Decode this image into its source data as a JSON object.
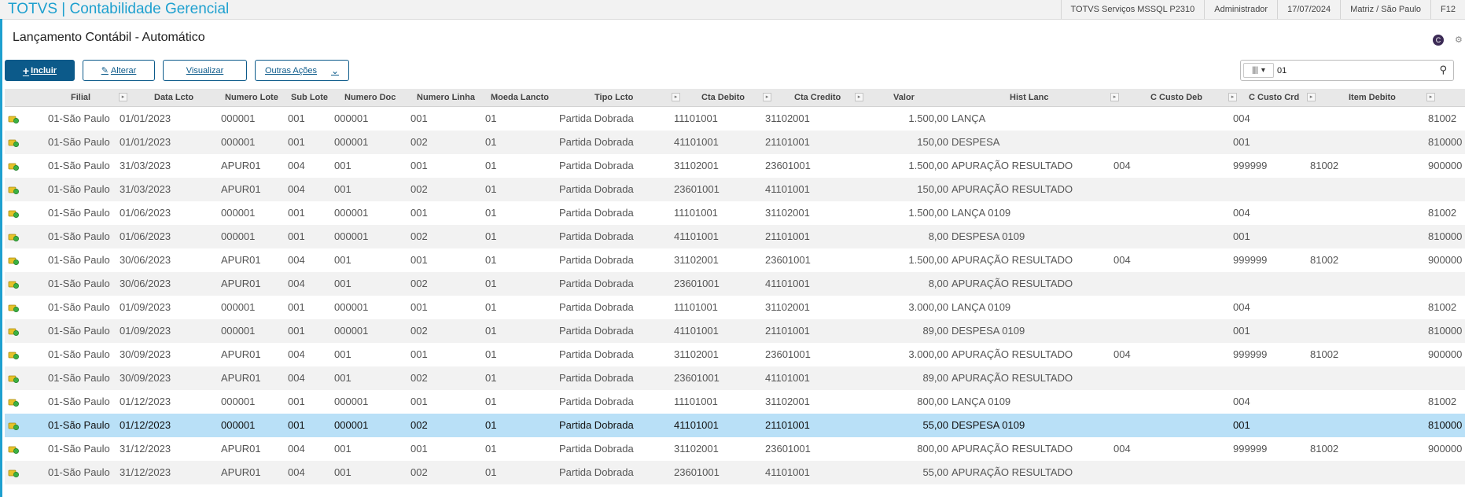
{
  "app": {
    "brand": "TOTVS | Contabilidade Gerencial"
  },
  "topbar": {
    "items": [
      "TOTVS Serviços MSSQL P2310",
      "Administrador",
      "17/07/2024",
      "Matriz / São Paulo",
      "F12"
    ]
  },
  "page": {
    "title": "Lançamento Contábil - Automático",
    "icon_letter": "C"
  },
  "toolbar": {
    "incluir_label": "Incluir",
    "alterar_label": "Alterar",
    "visualizar_label": "Visualizar",
    "outras_label": "Outras Ações"
  },
  "search": {
    "value": "01"
  },
  "colors": {
    "brand": "#1ea0cf",
    "button": "#0c5a8a",
    "selected_row": "#b9e0f7"
  },
  "table": {
    "headers": [
      "Filial",
      "Data Lcto",
      "Numero Lote",
      "Sub Lote",
      "Numero Doc",
      "Numero Linha",
      "Moeda Lancto",
      "Tipo Lcto",
      "Cta Debito",
      "Cta Credito",
      "Valor",
      "Hist Lanc",
      "C Custo Deb",
      "C Custo Crd",
      "Item Debito"
    ],
    "selected_index": 13,
    "rows": [
      {
        "filial": "01-São Paulo",
        "data": "01/01/2023",
        "lote": "000001",
        "sublote": "001",
        "doc": "000001",
        "linha": "001",
        "moeda": "01",
        "tipo": "Partida Dobrada",
        "deb": "11101001",
        "cred": "31102001",
        "valor": "1.500,00",
        "hist": "LANÇA",
        "ccdeb": "",
        "cccrd": "004",
        "c1": "",
        "c2": "",
        "itemdeb": "81002"
      },
      {
        "filial": "01-São Paulo",
        "data": "01/01/2023",
        "lote": "000001",
        "sublote": "001",
        "doc": "000001",
        "linha": "002",
        "moeda": "01",
        "tipo": "Partida Dobrada",
        "deb": "41101001",
        "cred": "21101001",
        "valor": "150,00",
        "hist": "DESPESA",
        "ccdeb": "",
        "cccrd": "001",
        "c1": "",
        "c2": "",
        "itemdeb": "810000"
      },
      {
        "filial": "01-São Paulo",
        "data": "31/03/2023",
        "lote": "APUR01",
        "sublote": "004",
        "doc": "001",
        "linha": "001",
        "moeda": "01",
        "tipo": "Partida Dobrada",
        "deb": "31102001",
        "cred": "23601001",
        "valor": "1.500,00",
        "hist": "APURAÇÃO RESULTADO",
        "ccdeb": "004",
        "cccrd": "999999",
        "c1": "81002",
        "c2": "",
        "itemdeb": "900000"
      },
      {
        "filial": "01-São Paulo",
        "data": "31/03/2023",
        "lote": "APUR01",
        "sublote": "004",
        "doc": "001",
        "linha": "002",
        "moeda": "01",
        "tipo": "Partida Dobrada",
        "deb": "23601001",
        "cred": "41101001",
        "valor": "150,00",
        "hist": "APURAÇÃO RESULTADO",
        "ccdeb": "",
        "cccrd": "",
        "c1": "",
        "c2": "",
        "itemdeb": ""
      },
      {
        "filial": "01-São Paulo",
        "data": "01/06/2023",
        "lote": "000001",
        "sublote": "001",
        "doc": "000001",
        "linha": "001",
        "moeda": "01",
        "tipo": "Partida Dobrada",
        "deb": "11101001",
        "cred": "31102001",
        "valor": "1.500,00",
        "hist": "LANÇA     0109",
        "ccdeb": "",
        "cccrd": "004",
        "c1": "",
        "c2": "",
        "itemdeb": "81002"
      },
      {
        "filial": "01-São Paulo",
        "data": "01/06/2023",
        "lote": "000001",
        "sublote": "001",
        "doc": "000001",
        "linha": "002",
        "moeda": "01",
        "tipo": "Partida Dobrada",
        "deb": "41101001",
        "cred": "21101001",
        "valor": "8,00",
        "hist": "DESPESA  0109",
        "ccdeb": "",
        "cccrd": "001",
        "c1": "",
        "c2": "",
        "itemdeb": "810000"
      },
      {
        "filial": "01-São Paulo",
        "data": "30/06/2023",
        "lote": "APUR01",
        "sublote": "004",
        "doc": "001",
        "linha": "001",
        "moeda": "01",
        "tipo": "Partida Dobrada",
        "deb": "31102001",
        "cred": "23601001",
        "valor": "1.500,00",
        "hist": "APURAÇÃO RESULTADO",
        "ccdeb": "004",
        "cccrd": "999999",
        "c1": "81002",
        "c2": "",
        "itemdeb": "900000"
      },
      {
        "filial": "01-São Paulo",
        "data": "30/06/2023",
        "lote": "APUR01",
        "sublote": "004",
        "doc": "001",
        "linha": "002",
        "moeda": "01",
        "tipo": "Partida Dobrada",
        "deb": "23601001",
        "cred": "41101001",
        "valor": "8,00",
        "hist": "APURAÇÃO RESULTADO",
        "ccdeb": "",
        "cccrd": "",
        "c1": "",
        "c2": "",
        "itemdeb": ""
      },
      {
        "filial": "01-São Paulo",
        "data": "01/09/2023",
        "lote": "000001",
        "sublote": "001",
        "doc": "000001",
        "linha": "001",
        "moeda": "01",
        "tipo": "Partida Dobrada",
        "deb": "11101001",
        "cred": "31102001",
        "valor": "3.000,00",
        "hist": "LANÇA     0109",
        "ccdeb": "",
        "cccrd": "004",
        "c1": "",
        "c2": "",
        "itemdeb": "81002"
      },
      {
        "filial": "01-São Paulo",
        "data": "01/09/2023",
        "lote": "000001",
        "sublote": "001",
        "doc": "000001",
        "linha": "002",
        "moeda": "01",
        "tipo": "Partida Dobrada",
        "deb": "41101001",
        "cred": "21101001",
        "valor": "89,00",
        "hist": "DESPESA  0109",
        "ccdeb": "",
        "cccrd": "001",
        "c1": "",
        "c2": "",
        "itemdeb": "810000"
      },
      {
        "filial": "01-São Paulo",
        "data": "30/09/2023",
        "lote": "APUR01",
        "sublote": "004",
        "doc": "001",
        "linha": "001",
        "moeda": "01",
        "tipo": "Partida Dobrada",
        "deb": "31102001",
        "cred": "23601001",
        "valor": "3.000,00",
        "hist": "APURAÇÃO RESULTADO",
        "ccdeb": "004",
        "cccrd": "999999",
        "c1": "81002",
        "c2": "",
        "itemdeb": "900000"
      },
      {
        "filial": "01-São Paulo",
        "data": "30/09/2023",
        "lote": "APUR01",
        "sublote": "004",
        "doc": "001",
        "linha": "002",
        "moeda": "01",
        "tipo": "Partida Dobrada",
        "deb": "23601001",
        "cred": "41101001",
        "valor": "89,00",
        "hist": "APURAÇÃO RESULTADO",
        "ccdeb": "",
        "cccrd": "",
        "c1": "",
        "c2": "",
        "itemdeb": ""
      },
      {
        "filial": "01-São Paulo",
        "data": "01/12/2023",
        "lote": "000001",
        "sublote": "001",
        "doc": "000001",
        "linha": "001",
        "moeda": "01",
        "tipo": "Partida Dobrada",
        "deb": "11101001",
        "cred": "31102001",
        "valor": "800,00",
        "hist": "LANÇA     0109",
        "ccdeb": "",
        "cccrd": "004",
        "c1": "",
        "c2": "",
        "itemdeb": "81002"
      },
      {
        "filial": "01-São Paulo",
        "data": "01/12/2023",
        "lote": "000001",
        "sublote": "001",
        "doc": "000001",
        "linha": "002",
        "moeda": "01",
        "tipo": "Partida Dobrada",
        "deb": "41101001",
        "cred": "21101001",
        "valor": "55,00",
        "hist": "DESPESA  0109",
        "ccdeb": "",
        "cccrd": "001",
        "c1": "",
        "c2": "",
        "itemdeb": "810000"
      },
      {
        "filial": "01-São Paulo",
        "data": "31/12/2023",
        "lote": "APUR01",
        "sublote": "004",
        "doc": "001",
        "linha": "001",
        "moeda": "01",
        "tipo": "Partida Dobrada",
        "deb": "31102001",
        "cred": "23601001",
        "valor": "800,00",
        "hist": "APURAÇÃO RESULTADO",
        "ccdeb": "004",
        "cccrd": "999999",
        "c1": "81002",
        "c2": "",
        "itemdeb": "900000"
      },
      {
        "filial": "01-São Paulo",
        "data": "31/12/2023",
        "lote": "APUR01",
        "sublote": "004",
        "doc": "001",
        "linha": "002",
        "moeda": "01",
        "tipo": "Partida Dobrada",
        "deb": "23601001",
        "cred": "41101001",
        "valor": "55,00",
        "hist": "APURAÇÃO RESULTADO",
        "ccdeb": "",
        "cccrd": "",
        "c1": "",
        "c2": "",
        "itemdeb": ""
      }
    ]
  }
}
